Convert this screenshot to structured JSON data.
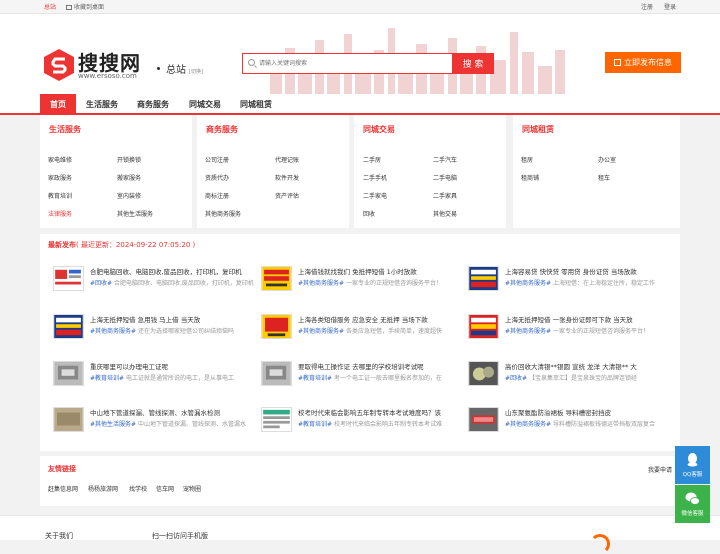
{
  "topbar": {
    "site": "总站",
    "bookmark": "收藏到桌面",
    "register": "注册",
    "login": "登录"
  },
  "header": {
    "logo_name": "搜搜网",
    "logo_url": "www.ersoso.com",
    "city": "总站",
    "city_switch": "[切换]",
    "search_placeholder": "请输入关键词搜索",
    "search_button": "搜 索",
    "post_button": "立即发布信息"
  },
  "nav": [
    "首页",
    "生活服务",
    "商务服务",
    "同城交易",
    "同城租赁"
  ],
  "categories": [
    {
      "title": "生活服务",
      "links": [
        "家电维修",
        "开锁换锁",
        "家政服务",
        "搬家服务",
        "教育培训",
        "室内装修",
        "法律服务",
        "其他生活服务"
      ]
    },
    {
      "title": "商务服务",
      "links": [
        "公司注册",
        "代理记账",
        "资质代办",
        "软件开发",
        "商标注册",
        "资产评估",
        "其他商务服务"
      ]
    },
    {
      "title": "同城交易",
      "links": [
        "二手房",
        "二手汽车",
        "二手手机",
        "二手电脑",
        "二手家电",
        "二手家具",
        "回收",
        "其他交易"
      ]
    },
    {
      "title": "同城租赁",
      "links": [
        "租房",
        "办公室",
        "租商铺",
        "租车"
      ]
    }
  ],
  "latest": {
    "title": "最新发布",
    "updated": "( 最近更新：2024-09-22 07:05:20 )",
    "posts": [
      {
        "title": "合肥电脑回收、电脑回收,废品回收，打印机，复印机",
        "tag": "#回收#",
        "desc": "合肥电脑回收、电脑回收,废品回收，打印机，复印机"
      },
      {
        "title": "上海借钱就找我们 免抵押短借 1小时放款",
        "tag": "#其他商务服务#",
        "desc": "一家专业的正规短借咨询服务平台！"
      },
      {
        "title": "上海容易贷 快快贷 零用贷 身份证贷 当场放款",
        "tag": "#其他商务服务#",
        "desc": "上海短借：在上海稳定住所，稳定工作"
      },
      {
        "title": "上海无抵押短借 急用钱 马上借 当天放",
        "tag": "#其他商务服务#",
        "desc": "还在为选择哪家短借公司纠结烦恼吗"
      },
      {
        "title": "上海各类短借服务 应急安全 无抵押 当场下款",
        "tag": "#其他商务服务#",
        "desc": "各类应急短借，手续简单，速度超快"
      },
      {
        "title": "上海无抵押短借 一张身份证即可下款 当天放",
        "tag": "#其他商务服务#",
        "desc": "一家专业的正规短借咨询服务平台！"
      },
      {
        "title": "重庆哪里可以办理电工证呢",
        "tag": "#教育培训#",
        "desc": "电工证就是通常所说的电工，是从事电工"
      },
      {
        "title": "要取得电工操作证 去哪里的学校培训考试呢",
        "tag": "#教育培训#",
        "desc": "考一个电工证一般去哪里报名参加的，在"
      },
      {
        "title": "高价回收大清银**银圆 宣统 龙洋 大清银** 大",
        "tag": "#回收#",
        "desc": "【宝泉集萃汇】是宝泉珠宝的品牌连锁经"
      },
      {
        "title": "中山地下管道探漏、管线探测、水管漏水检测",
        "tag": "#其他生活服务#",
        "desc": "中山地下管道探漏、管线探测、水管漏水"
      },
      {
        "title": "校考时代来临会影响五年制专转本考试难度吗？该",
        "tag": "#教育培训#",
        "desc": "校考时代来临会影响五年制专转本考试难"
      },
      {
        "title": "山东聚氨酯防溢裙板 导料槽密封挡皮",
        "tag": "#其他商务服务#",
        "desc": "导料槽防溢裙板钱德运带挡板双层复合"
      }
    ]
  },
  "friend_links": {
    "title": "友情链接",
    "apply": "我要申请",
    "links": [
      "赶集信息网",
      "杨杨旅游网",
      "找学校",
      "信车网",
      "宠物圈"
    ]
  },
  "footer": {
    "about": "关于我们",
    "scan": "扫一扫访问手机版"
  },
  "float": {
    "qq": "QQ客服",
    "wechat": "微信客服"
  }
}
